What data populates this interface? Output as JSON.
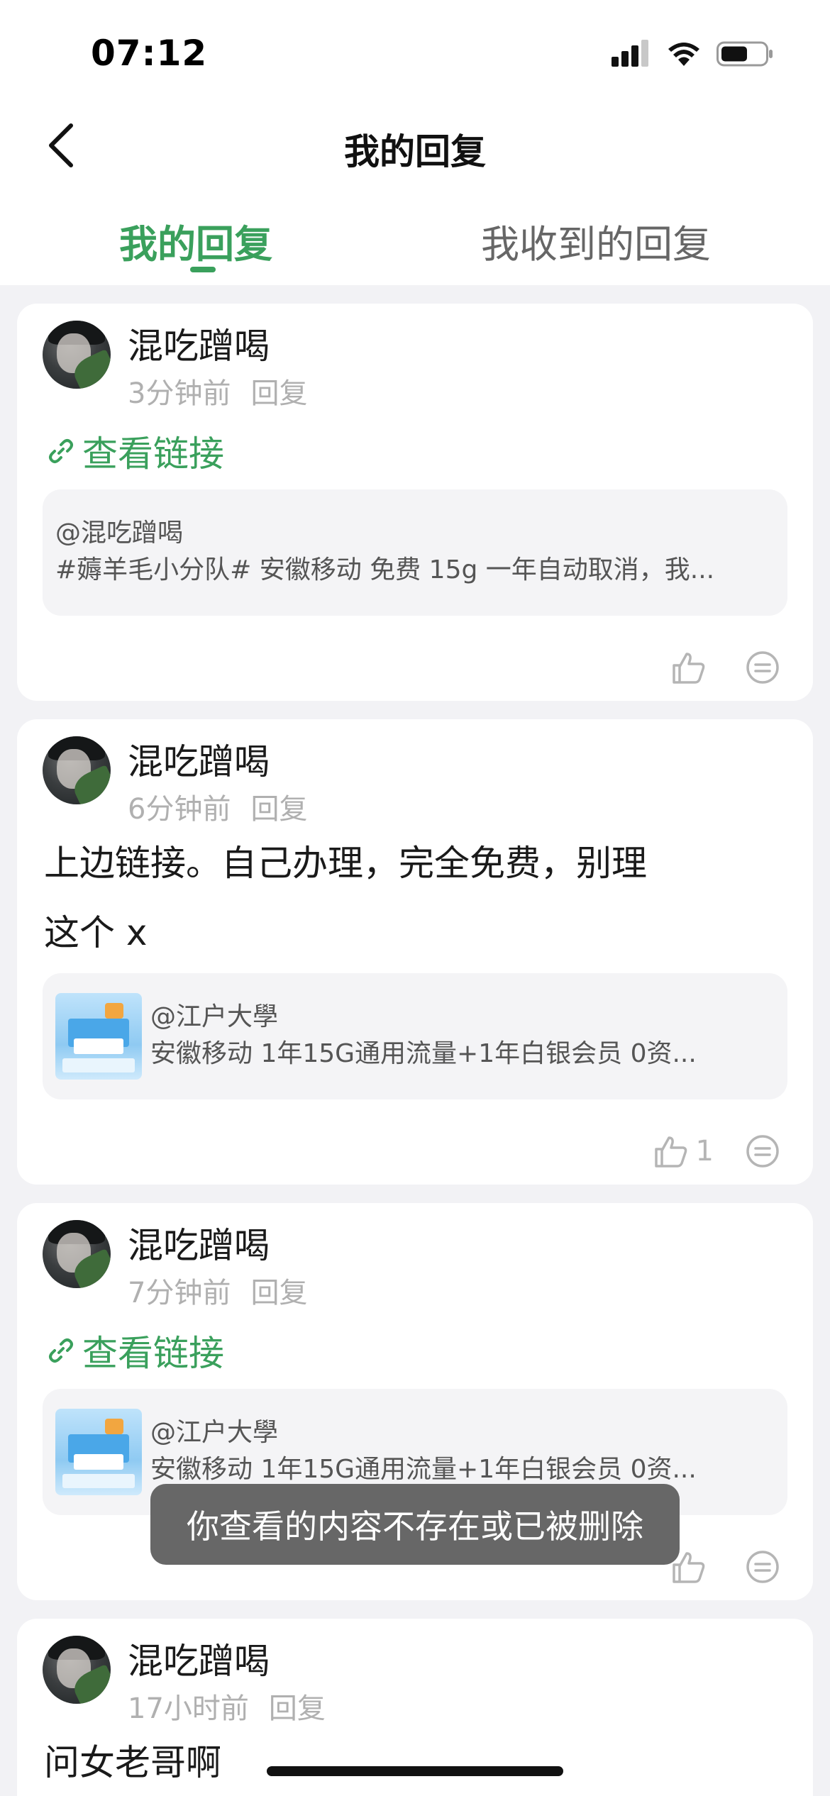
{
  "status_bar": {
    "time": "07:12",
    "battery_percent": 60
  },
  "nav": {
    "title": "我的回复"
  },
  "tabs": [
    {
      "label": "我的回复",
      "active": true
    },
    {
      "label": "我收到的回复",
      "active": false
    }
  ],
  "cards": [
    {
      "username": "混吃蹭喝",
      "time": "3分钟前",
      "action": "回复",
      "link_text": "查看链接",
      "quote_user": "@混吃蹭喝",
      "quote_text": "#薅羊毛小分队# 安徽移动 免费 15g 一年自动取消，我...",
      "likes": ""
    },
    {
      "username": "混吃蹭喝",
      "time": "6分钟前",
      "action": "回复",
      "body_lines": [
        "上边链接。自己办理，完全免费，别理",
        "这个 x"
      ],
      "quote_user": "@江户大學",
      "quote_text": "安徽移动 1年15G通用流量+1年白银会员 0资...",
      "likes": "1"
    },
    {
      "username": "混吃蹭喝",
      "time": "7分钟前",
      "action": "回复",
      "link_text": "查看链接",
      "quote_user": "@江户大學",
      "quote_text": "安徽移动 1年15G通用流量+1年白银会员 0资...",
      "likes": ""
    },
    {
      "username": "混吃蹭喝",
      "time": "17小时前",
      "action": "回复",
      "body_lines": [
        "问女老哥啊"
      ]
    }
  ],
  "toast": {
    "text": "你查看的内容不存在或已被删除"
  },
  "colors": {
    "accent": "#3aa05c",
    "background": "#f2f2f5",
    "muted": "#b0b0b0"
  }
}
